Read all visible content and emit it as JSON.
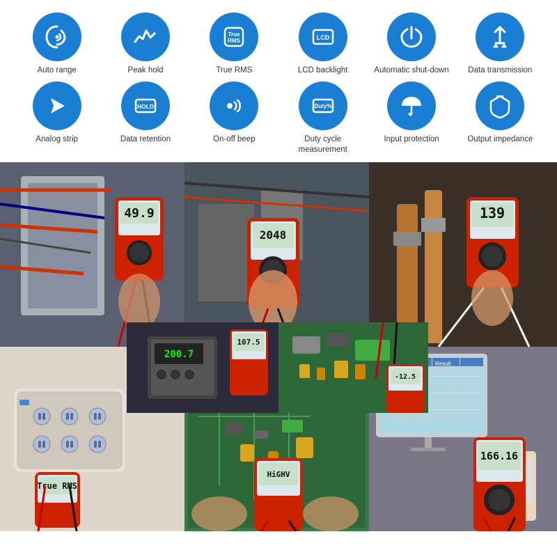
{
  "features": [
    {
      "id": "auto-range",
      "label": "Auto range",
      "icon_type": "spiral",
      "icon_char": "◎"
    },
    {
      "id": "peak-hold",
      "label": "Peak hold",
      "icon_type": "wave",
      "icon_char": "∿"
    },
    {
      "id": "true-rms",
      "label": "True RMS",
      "icon_type": "text",
      "icon_text_line1": "True",
      "icon_text_line2": "RMS"
    },
    {
      "id": "lcd-backlight",
      "label": "LCD backlight",
      "icon_type": "lcd",
      "icon_text": "LCD"
    },
    {
      "id": "auto-shutdown",
      "label": "Automatic shut-down",
      "icon_type": "power",
      "icon_char": "⏻"
    },
    {
      "id": "data-transmission",
      "label": "Data transmission",
      "icon_type": "usb",
      "icon_char": "⋔"
    },
    {
      "id": "analog-strip",
      "label": "Analog strip",
      "icon_type": "arrow",
      "icon_char": "➤"
    },
    {
      "id": "data-retention",
      "label": "Data retention",
      "icon_type": "hold",
      "icon_text": "HOLD"
    },
    {
      "id": "on-off-beep",
      "label": "On-off beep",
      "icon_type": "sound",
      "icon_char": "◉))"
    },
    {
      "id": "duty-cycle",
      "label": "Duty cycle measurement",
      "icon_type": "duty",
      "icon_text": "Duty%"
    },
    {
      "id": "input-protection",
      "label": "Input protection",
      "icon_type": "umbrella",
      "icon_char": "☂"
    },
    {
      "id": "output-impedance",
      "label": "Output impedance",
      "icon_type": "shield",
      "icon_char": "🛡"
    }
  ],
  "photos": [
    {
      "id": "photo-electrical-panel",
      "alt": "Multimeter measuring electrical panel, display shows 49.9",
      "display_value": "49.9"
    },
    {
      "id": "photo-large-measurement",
      "alt": "Multimeter measuring, display shows 2048",
      "display_value": "2048"
    },
    {
      "id": "photo-pipe-measurement",
      "alt": "Multimeter measuring pipe, display shows 139",
      "display_value": "139"
    },
    {
      "id": "photo-power-supply",
      "alt": "Small multimeter with power supply, display shows 200.7",
      "display_value": "200.7"
    },
    {
      "id": "photo-circuit-board",
      "alt": "Multimeter on circuit board, display shows value",
      "display_value": "---"
    },
    {
      "id": "photo-power-strip",
      "alt": "Multimeter on power strip",
      "display_value": "---"
    },
    {
      "id": "photo-green-board",
      "alt": "Multimeter measuring green circuit board",
      "display_value": "---"
    },
    {
      "id": "photo-computer",
      "alt": "Multimeter with computer display, shows 166.16",
      "display_value": "166.16"
    }
  ],
  "brand_color": "#1a7fd4"
}
